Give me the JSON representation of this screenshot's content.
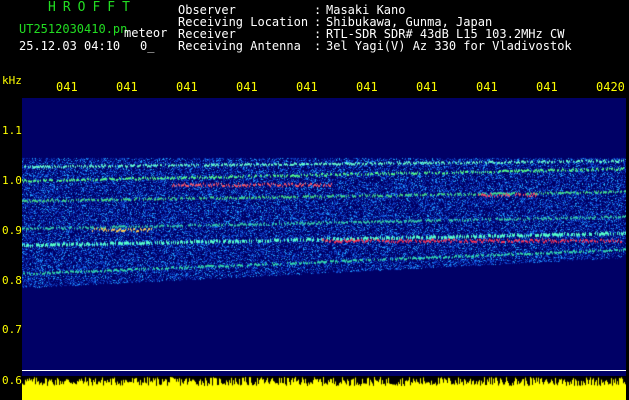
{
  "header": {
    "brand": "HROFFT",
    "filename": "UT2512030410.pn",
    "filename_suffix": "meteor",
    "datetime": "25.12.03 04:10",
    "datetime_suffix": "0_",
    "info": [
      {
        "label": "Observer",
        "value": "Masaki Kano"
      },
      {
        "label": "Receiving Location",
        "value": "Shibukawa, Gunma, Japan"
      },
      {
        "label": "Receiver",
        "value": "RTL-SDR SDR# 43dB L15 103.2MHz CW"
      },
      {
        "label": "Receiving Antenna",
        "value": "3el Yagi(V) Az 330 for Vladivostok"
      }
    ]
  },
  "axes": {
    "freq_unit": "kHz",
    "freq_ticks": [
      "1.1",
      "1.0",
      "0.9",
      "0.8",
      "0.7",
      "0.6"
    ],
    "time_ticks": [
      "041",
      "041",
      "041",
      "041",
      "041",
      "041",
      "041",
      "041",
      "041",
      "0420"
    ]
  },
  "colors": {
    "background": "#000000",
    "text_green": "#22dd22",
    "text_white": "#ffffff",
    "axis_yellow": "#ffff00",
    "plot_bg": "#00007a",
    "level_bar": "#ffff00"
  }
}
